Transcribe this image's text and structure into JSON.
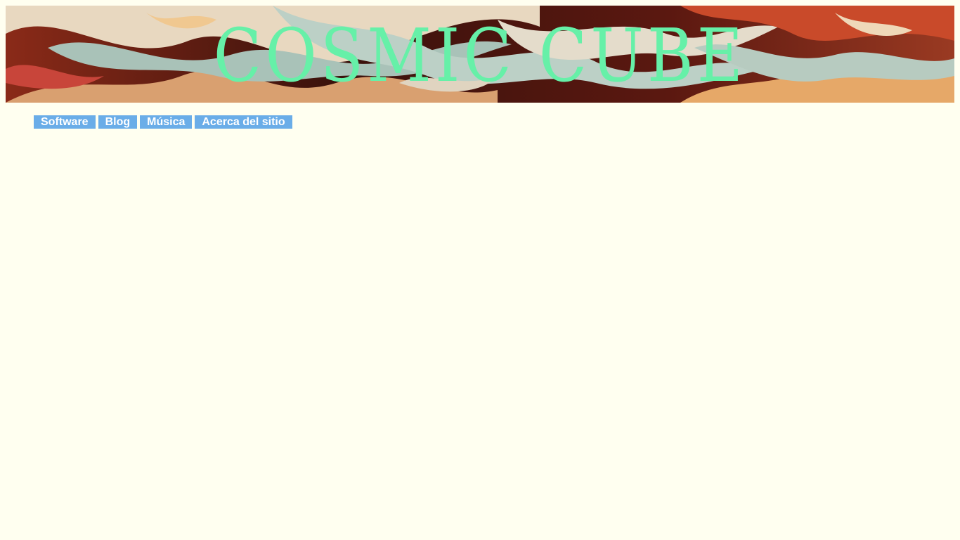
{
  "header": {
    "site_title": "COSMIC CUBE"
  },
  "nav": {
    "items": [
      {
        "label": "Software"
      },
      {
        "label": "Blog"
      },
      {
        "label": "Música"
      },
      {
        "label": "Acerca del sitio"
      }
    ]
  },
  "colors": {
    "page_background": "#fffff0",
    "title": "#66f0a8",
    "nav_background": "#6aade8",
    "nav_text": "#ffffff"
  }
}
